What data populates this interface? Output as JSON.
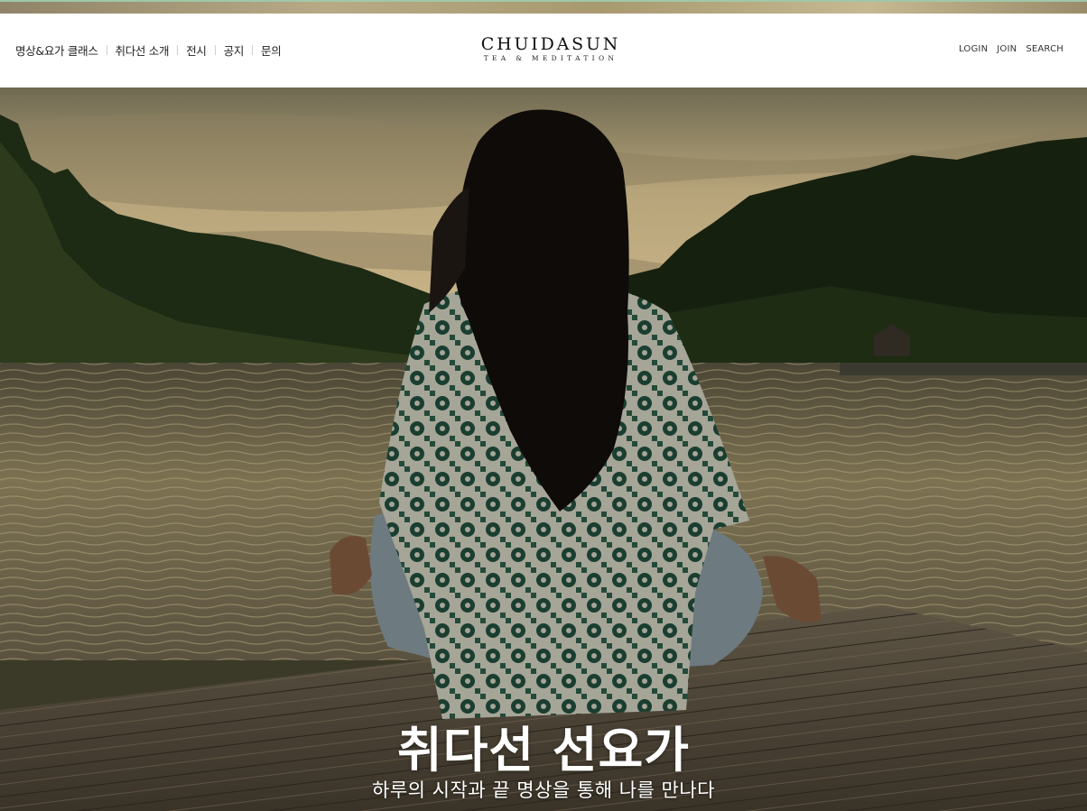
{
  "header": {
    "nav": [
      {
        "label": "명상&요가 클래스"
      },
      {
        "label": "취다선 소개"
      },
      {
        "label": "전시"
      },
      {
        "label": "공지"
      },
      {
        "label": "문의"
      }
    ],
    "logo": {
      "main": "CHUIDASUN",
      "sub": "TEA & MEDITATION"
    },
    "util": {
      "login": "LOGIN",
      "join": "JOIN",
      "search": "SEARCH"
    }
  },
  "hero": {
    "title": "취다선 선요가",
    "subtitle": "하루의 시작과 끝 명상을 통해 나를 만나다"
  },
  "colors": {
    "header_bg": "#ffffff",
    "text_dark": "#222222",
    "hero_text": "#ffffff"
  }
}
